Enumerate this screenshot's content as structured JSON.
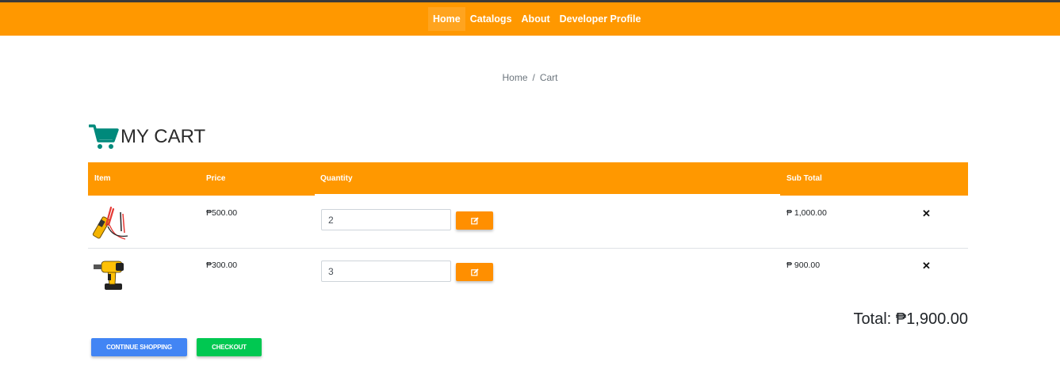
{
  "nav": {
    "items": [
      {
        "label": "Home",
        "active": true
      },
      {
        "label": "Catalogs"
      },
      {
        "label": "About"
      },
      {
        "label": "Developer Profile"
      }
    ]
  },
  "breadcrumb": {
    "home": "Home",
    "separator": "/",
    "current": "Cart"
  },
  "cart": {
    "title": "MY CART",
    "icon": "cart-icon"
  },
  "table": {
    "headers": {
      "item": "Item",
      "price": "Price",
      "quantity": "Quantity",
      "subtotal": "Sub Total"
    },
    "rows": [
      {
        "image": "multimeter-image",
        "price": "₱500.00",
        "quantity": "2",
        "subtotal": "₱ 1,000.00",
        "remove": "✕"
      },
      {
        "image": "power-drill-image",
        "price": "₱300.00",
        "quantity": "3",
        "subtotal": "₱ 900.00",
        "remove": "✕"
      }
    ]
  },
  "total": {
    "label": "Total: ₱1,900.00"
  },
  "actions": {
    "continue": "CONTINUE SHOPPING",
    "checkout": "CHECKOUT"
  },
  "colors": {
    "brand": "#ff9800",
    "continue_button": "#4285f4",
    "checkout_button": "#00c851",
    "cart_icon": "#00897b"
  }
}
